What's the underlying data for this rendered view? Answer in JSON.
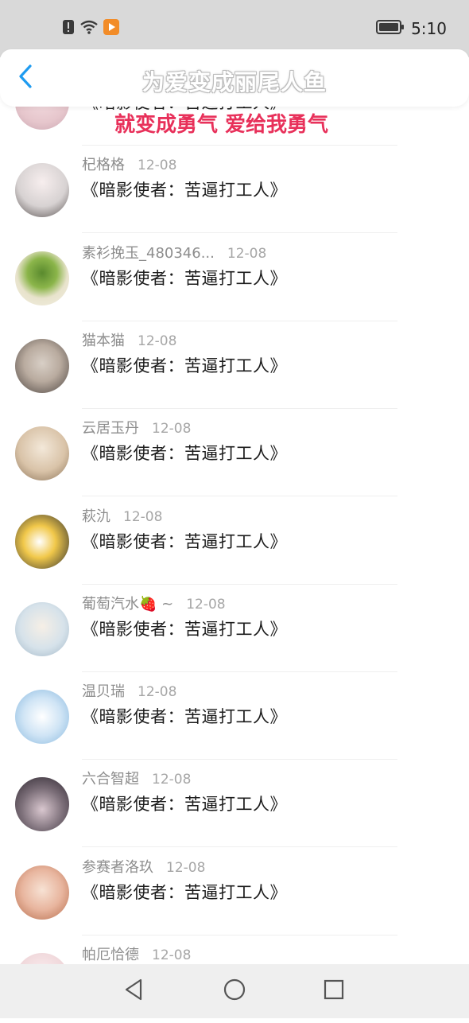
{
  "status_bar": {
    "time": "5:10",
    "icons": [
      "alert-icon",
      "wifi-icon",
      "app-notification-icon",
      "battery-icon"
    ]
  },
  "header": {
    "title": "为爱变成丽尾人鱼",
    "back_icon": "chevron-left-icon"
  },
  "overlay": {
    "danmaku_text": "就变成勇气 爱给我勇气"
  },
  "list": {
    "items": [
      {
        "name": "",
        "date": "",
        "content": "《暗影使者：苦逼打工人》",
        "avatar_color": "#e6c6cc"
      },
      {
        "name": "杞格格",
        "date": "12-08",
        "content": "《暗影使者：苦逼打工人》",
        "avatar_color": "#d7d2d2"
      },
      {
        "name": "素衫挽玉_480346...",
        "date": "12-08",
        "content": "《暗影使者：苦逼打工人》",
        "avatar_color": "#e8e3cc"
      },
      {
        "name": "猫本猫",
        "date": "12-08",
        "content": "《暗影使者：苦逼打工人》",
        "avatar_color": "#b9ab9f"
      },
      {
        "name": "云居玉丹",
        "date": "12-08",
        "content": "《暗影使者：苦逼打工人》",
        "avatar_color": "#d9c3a8"
      },
      {
        "name": "萩氿",
        "date": "12-08",
        "content": "《暗影使者：苦逼打工人》",
        "avatar_color": "#f1c84a"
      },
      {
        "name": "葡萄汽水🍓 ~",
        "date": "12-08",
        "content": "《暗影使者：苦逼打工人》",
        "avatar_color": "#d6e2ea"
      },
      {
        "name": "温贝瑞",
        "date": "12-08",
        "content": "《暗影使者：苦逼打工人》",
        "avatar_color": "#cfe4f5"
      },
      {
        "name": "六合智超",
        "date": "12-08",
        "content": "《暗影使者：苦逼打工人》",
        "avatar_color": "#7b6e78"
      },
      {
        "name": "参赛者洛玖",
        "date": "12-08",
        "content": "《暗影使者：苦逼打工人》",
        "avatar_color": "#e8b59e"
      },
      {
        "name": "帕厄恰德",
        "date": "12-08",
        "content": "",
        "avatar_color": "#efd6d9"
      }
    ]
  },
  "nav_bar": {
    "back": "triangle-back-icon",
    "home": "circle-home-icon",
    "recent": "square-recent-icon"
  },
  "colors": {
    "accent": "#1e9bf0",
    "danmaku": "#e8305a",
    "status_bar_bg": "#d9d9d9",
    "nav_bar_bg": "#efefef"
  }
}
